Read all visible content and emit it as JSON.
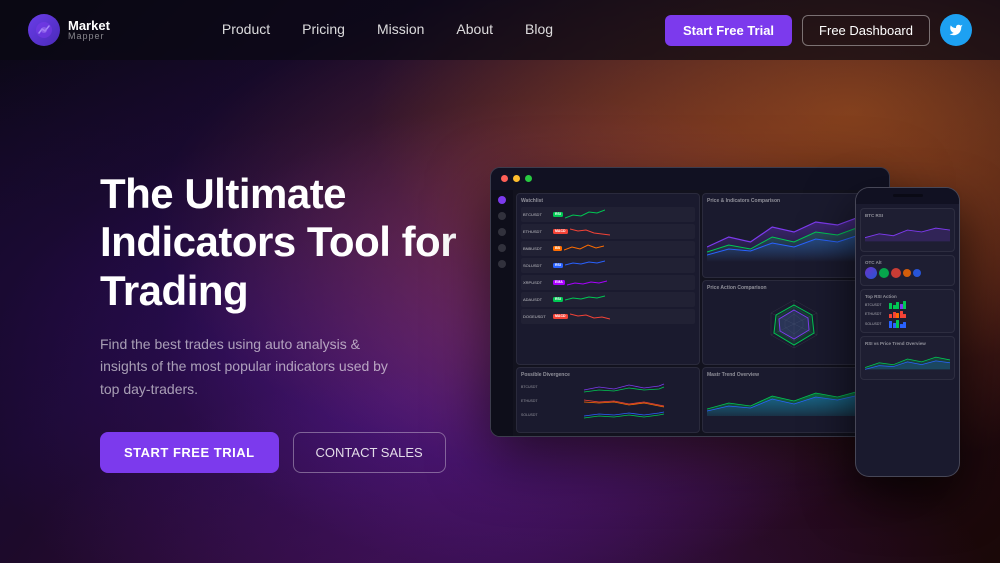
{
  "brand": {
    "name": "Market",
    "sub": "Mapper",
    "logo_label": "Market Mapper"
  },
  "nav": {
    "links": [
      {
        "label": "Product",
        "href": "#"
      },
      {
        "label": "Pricing",
        "href": "#"
      },
      {
        "label": "Mission",
        "href": "#"
      },
      {
        "label": "About",
        "href": "#"
      },
      {
        "label": "Blog",
        "href": "#"
      }
    ],
    "cta_trial": "Start Free Trial",
    "cta_dashboard": "Free Dashboard"
  },
  "hero": {
    "title": "The Ultimate Indicators Tool for Trading",
    "subtitle": "Find the best trades using auto analysis & insights of the most popular indicators used by top day-traders.",
    "btn_trial": "START FREE TRIAL",
    "btn_contact": "CONTACT SALES"
  },
  "watchlist": {
    "title": "Watchlist",
    "items": [
      {
        "name": "BTCUSDT",
        "badge": "RSI",
        "badge_type": "green"
      },
      {
        "name": "ETHUSDT",
        "badge": "MACD",
        "badge_type": "red"
      },
      {
        "name": "BNBUSDT",
        "badge": "BB",
        "badge_type": "orange"
      },
      {
        "name": "SOLUSDT",
        "badge": "RSI",
        "badge_type": "blue"
      },
      {
        "name": "XRPUSDT",
        "badge": "EMA",
        "badge_type": "purple"
      },
      {
        "name": "ADAUSDT",
        "badge": "RSI",
        "badge_type": "green"
      },
      {
        "name": "DOGEUSDT",
        "badge": "MACD",
        "badge_type": "red"
      }
    ]
  },
  "indicators": {
    "title": "Price & Indicators Comparison"
  },
  "spider": {
    "title": "Price Action Comparison"
  },
  "macd": {
    "title": "Mastr Trend Overview"
  },
  "phone": {
    "panels": [
      {
        "title": "BTC RSI"
      },
      {
        "title": "OTC Alt"
      },
      {
        "title": "Top RSI Action"
      },
      {
        "title": "RSI vs Price Trend Overview"
      }
    ]
  }
}
